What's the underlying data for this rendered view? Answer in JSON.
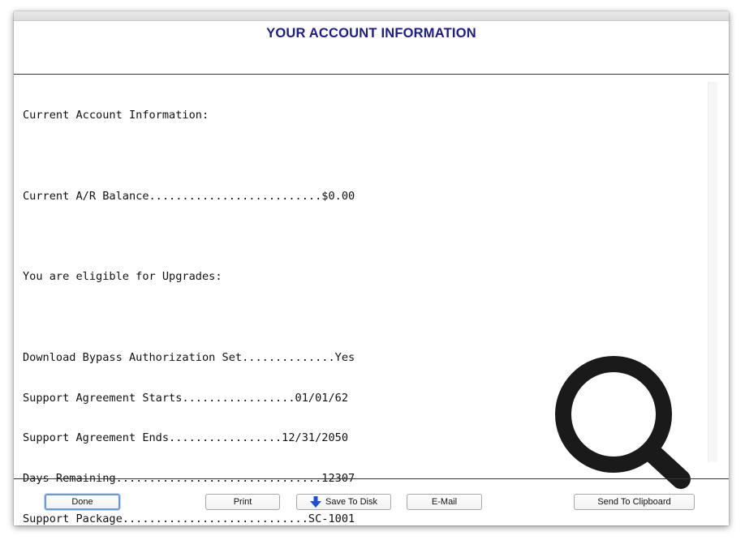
{
  "window": {
    "title": "YOUR ACCOUNT INFORMATION"
  },
  "report": {
    "heading": "Current Account Information:",
    "balance_line": "Current A/R Balance..........................$0.00",
    "eligibility": "You are eligible for Upgrades:",
    "details": [
      "Download Bypass Authorization Set..............Yes",
      "Support Agreement Starts.................01/01/62",
      "Support Agreement Ends.................12/31/2050",
      "Days Remaining...............................12307",
      "Support Package............................SC-1001"
    ]
  },
  "buttons": {
    "done": "Done",
    "print": "Print",
    "save_to_disk": "Save To Disk",
    "email": "E-Mail",
    "send_to_clipboard": "Send To Clipboard"
  },
  "icons": {
    "save_arrow": "down-arrow-icon",
    "magnifier": "magnifier-icon"
  },
  "colors": {
    "title": "#1c1c8c",
    "save_arrow": "#1f4fd6",
    "default_button_ring": "#6a9bd8"
  }
}
